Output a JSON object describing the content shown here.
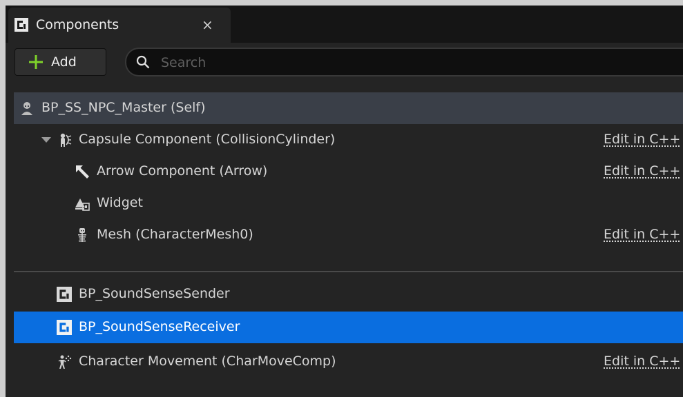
{
  "tab": {
    "title": "Components",
    "close": "×"
  },
  "toolbar": {
    "add_label": "Add",
    "search_placeholder": "Search"
  },
  "tree": {
    "self": {
      "label": "BP_SS_NPC_Master (Self)"
    },
    "capsule": {
      "label": "Capsule Component (CollisionCylinder)",
      "edit": "Edit in C++"
    },
    "arrow": {
      "label": "Arrow Component (Arrow)",
      "edit": "Edit in C++"
    },
    "widget": {
      "label": "Widget"
    },
    "mesh": {
      "label": "Mesh (CharacterMesh0)",
      "edit": "Edit in C++"
    },
    "sender": {
      "label": "BP_SoundSenseSender"
    },
    "receiver": {
      "label": "BP_SoundSenseReceiver",
      "selected": true
    },
    "movement": {
      "label": "Character Movement (CharMoveComp)",
      "edit": "Edit in C++"
    }
  },
  "colors": {
    "selected": "#0a6ee0",
    "add_plus": "#7fd32a",
    "panel_bg": "#242424"
  }
}
